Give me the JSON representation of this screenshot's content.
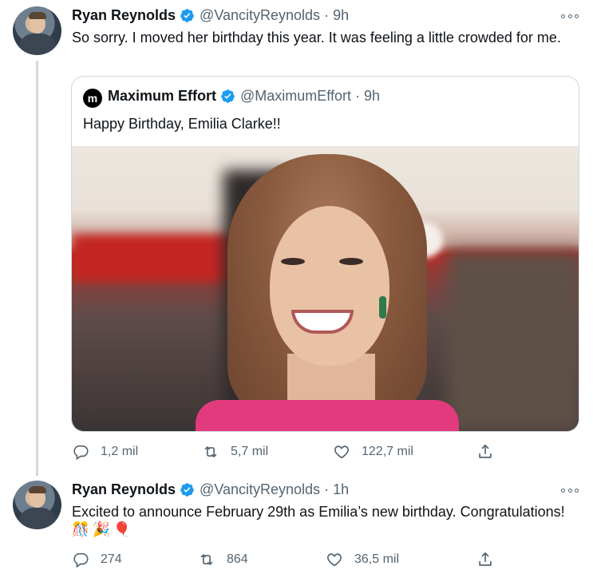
{
  "tweets": [
    {
      "author_name": "Ryan Reynolds",
      "handle": "@VancityReynolds",
      "separator": "·",
      "time": "9h",
      "text": "So sorry. I moved her birthday this year. It was feeling a little crowded for me.",
      "quote": {
        "author_name": "Maximum Effort",
        "avatar_letter": "m",
        "handle": "@MaximumEffort",
        "separator": "·",
        "time": "9h",
        "text": "Happy Birthday, Emilia Clarke!!"
      },
      "actions": {
        "replies": "1,2 mil",
        "retweets": "5,7 mil",
        "likes": "122,7 mil"
      }
    },
    {
      "author_name": "Ryan Reynolds",
      "handle": "@VancityReynolds",
      "separator": "·",
      "time": "1h",
      "text": "Excited to announce February 29th as Emilia’s new birthday. Congratulations!",
      "emoji": [
        "🎊",
        "🎉",
        "🎈"
      ],
      "actions": {
        "replies": "274",
        "retweets": "864",
        "likes": "36,5 mil"
      }
    }
  ],
  "colors": {
    "primary_text": "#0f1419",
    "secondary_text": "#536471",
    "verified_blue": "#1d9bf0",
    "border": "#cfd9de"
  },
  "icons": [
    "verified-badge-icon",
    "more-icon",
    "reply-icon",
    "retweet-icon",
    "like-icon",
    "share-icon"
  ]
}
